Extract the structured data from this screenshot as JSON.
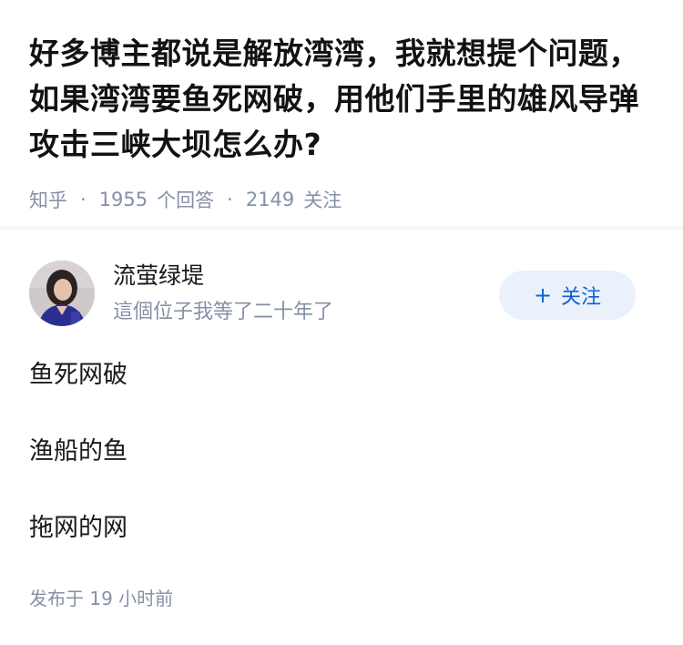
{
  "question": {
    "title": "好多博主都说是解放湾湾，我就想提个问题，如果湾湾要鱼死网破，用他们手里的雄风导弹攻击三峡大坝怎么办?",
    "source": "知乎",
    "answer_count": "1955",
    "answer_label": "个回答",
    "follower_count": "2149",
    "follower_label": "关注"
  },
  "author": {
    "name": "流萤绿堤",
    "bio": "這個位子我等了二十年了",
    "avatar_icon": "avatar-photo",
    "follow_label": "关注",
    "follow_icon": "plus-icon",
    "accent_color": "#0d63d6"
  },
  "answer": {
    "paragraphs": [
      "鱼死网破",
      "渔船的鱼",
      "拖网的网"
    ],
    "published_label": "发布于",
    "published_value": "19 小时前"
  }
}
